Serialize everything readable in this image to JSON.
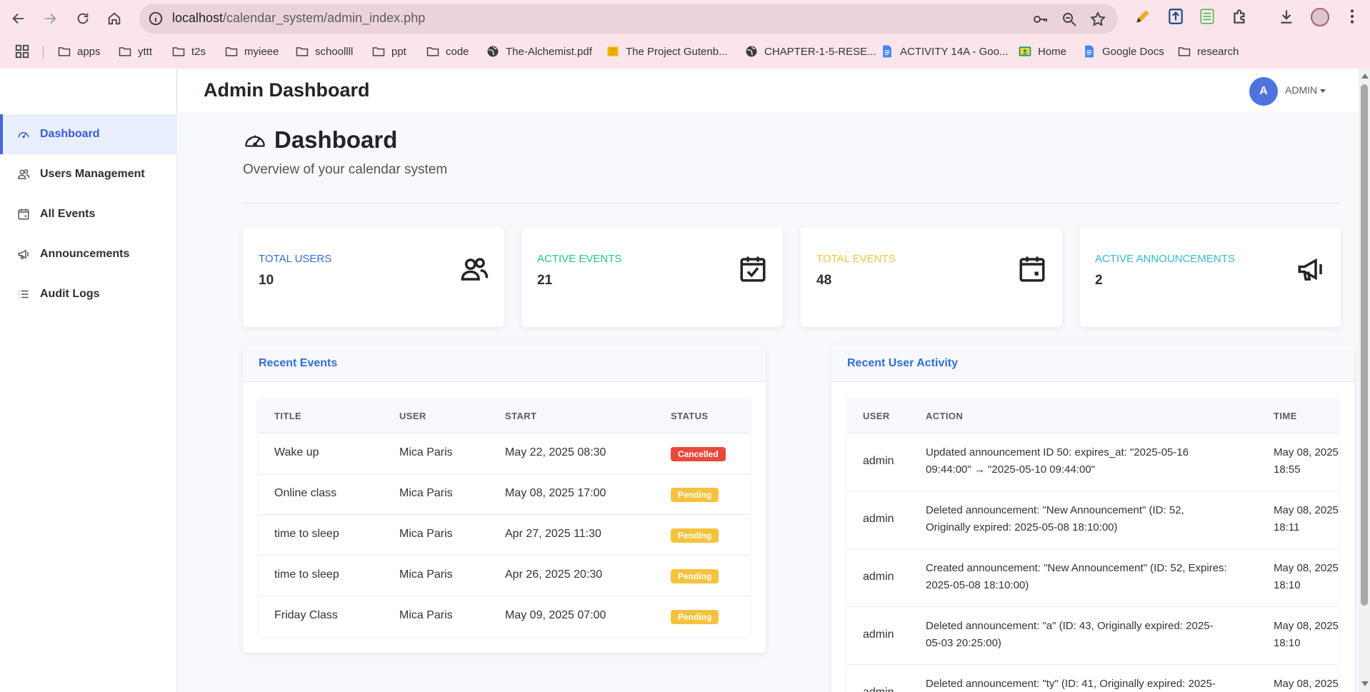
{
  "browser": {
    "url_host": "localhost",
    "url_path": "/calendar_system/admin_index.php",
    "bookmarks": [
      {
        "label": "apps",
        "icon": "folder-icon"
      },
      {
        "label": "yttt",
        "icon": "folder-icon"
      },
      {
        "label": "t2s",
        "icon": "folder-icon"
      },
      {
        "label": "myieee",
        "icon": "folder-icon"
      },
      {
        "label": "schoollll",
        "icon": "folder-icon"
      },
      {
        "label": "ppt",
        "icon": "folder-icon"
      },
      {
        "label": "code",
        "icon": "folder-icon"
      },
      {
        "label": "The-Alchemist.pdf",
        "icon": "globe-icon"
      },
      {
        "label": "The Project Gutenb...",
        "icon": "book-icon"
      },
      {
        "label": "CHAPTER-1-5-RESE...",
        "icon": "globe-icon"
      },
      {
        "label": "ACTIVITY 14A - Goo...",
        "icon": "docs-icon"
      },
      {
        "label": "Home",
        "icon": "classroom-icon"
      },
      {
        "label": "Google Docs",
        "icon": "docs-icon"
      },
      {
        "label": "research",
        "icon": "folder-icon"
      }
    ]
  },
  "sidebar": {
    "items": [
      {
        "label": "Dashboard",
        "icon": "speedometer-icon",
        "active": true
      },
      {
        "label": "Users Management",
        "icon": "users-icon"
      },
      {
        "label": "All Events",
        "icon": "calendar-icon"
      },
      {
        "label": "Announcements",
        "icon": "megaphone-icon"
      },
      {
        "label": "Audit Logs",
        "icon": "list-icon"
      }
    ]
  },
  "topbar": {
    "title": "Admin Dashboard",
    "avatar_initial": "A",
    "user_label": "ADMIN"
  },
  "page": {
    "title": "Dashboard",
    "subtitle": "Overview of your calendar system"
  },
  "stats": [
    {
      "label": "TOTAL USERS",
      "value": "10",
      "color": "#2e6fd6",
      "icon": "users-icon"
    },
    {
      "label": "ACTIVE EVENTS",
      "value": "21",
      "color": "#1cc88a",
      "icon": "calendar-check-icon"
    },
    {
      "label": "TOTAL EVENTS",
      "value": "48",
      "color": "#f6c23e",
      "icon": "calendar-icon"
    },
    {
      "label": "ACTIVE ANNOUNCEMENTS",
      "value": "2",
      "color": "#36b9cc",
      "icon": "megaphone-icon"
    }
  ],
  "recent_events": {
    "title": "Recent Events",
    "columns": [
      "TITLE",
      "USER",
      "START",
      "STATUS"
    ],
    "rows": [
      {
        "title": "Wake up",
        "user": "Mica Paris",
        "start": "May 22, 2025 08:30",
        "status": "Cancelled"
      },
      {
        "title": "Online class",
        "user": "Mica Paris",
        "start": "May 08, 2025 17:00",
        "status": "Pending"
      },
      {
        "title": "time to sleep",
        "user": "Mica Paris",
        "start": "Apr 27, 2025 11:30",
        "status": "Pending"
      },
      {
        "title": "time to sleep",
        "user": "Mica Paris",
        "start": "Apr 26, 2025 20:30",
        "status": "Pending"
      },
      {
        "title": "Friday Class",
        "user": "Mica Paris",
        "start": "May 09, 2025 07:00",
        "status": "Pending"
      }
    ]
  },
  "recent_activity": {
    "title": "Recent User Activity",
    "columns": [
      "USER",
      "ACTION",
      "TIME"
    ],
    "rows": [
      {
        "user": "admin",
        "action_line1": "Updated announcement ID 50: expires_at: \"2025-05-16",
        "action_line2": "09:44:00\" → \"2025-05-10 09:44:00\"",
        "time_line1": "May 08, 2025",
        "time_line2": "18:55"
      },
      {
        "user": "admin",
        "action_line1": "Deleted announcement: \"New Announcement\" (ID: 52,",
        "action_line2": "Originally expired: 2025-05-08 18:10:00)",
        "time_line1": "May 08, 2025",
        "time_line2": "18:11"
      },
      {
        "user": "admin",
        "action_line1": "Created announcement: \"New Announcement\" (ID: 52, Expires:",
        "action_line2": "2025-05-08 18:10:00)",
        "time_line1": "May 08, 2025",
        "time_line2": "18:10"
      },
      {
        "user": "admin",
        "action_line1": "Deleted announcement: \"a\" (ID: 43, Originally expired: 2025-",
        "action_line2": "05-03 20:25:00)",
        "time_line1": "May 08, 2025",
        "time_line2": "18:10"
      },
      {
        "user": "admin",
        "action_line1": "Deleted announcement: \"ty\" (ID: 41, Originally expired: 2025-",
        "action_line2": "",
        "time_line1": "May 08, 2025",
        "time_line2": ""
      }
    ]
  }
}
